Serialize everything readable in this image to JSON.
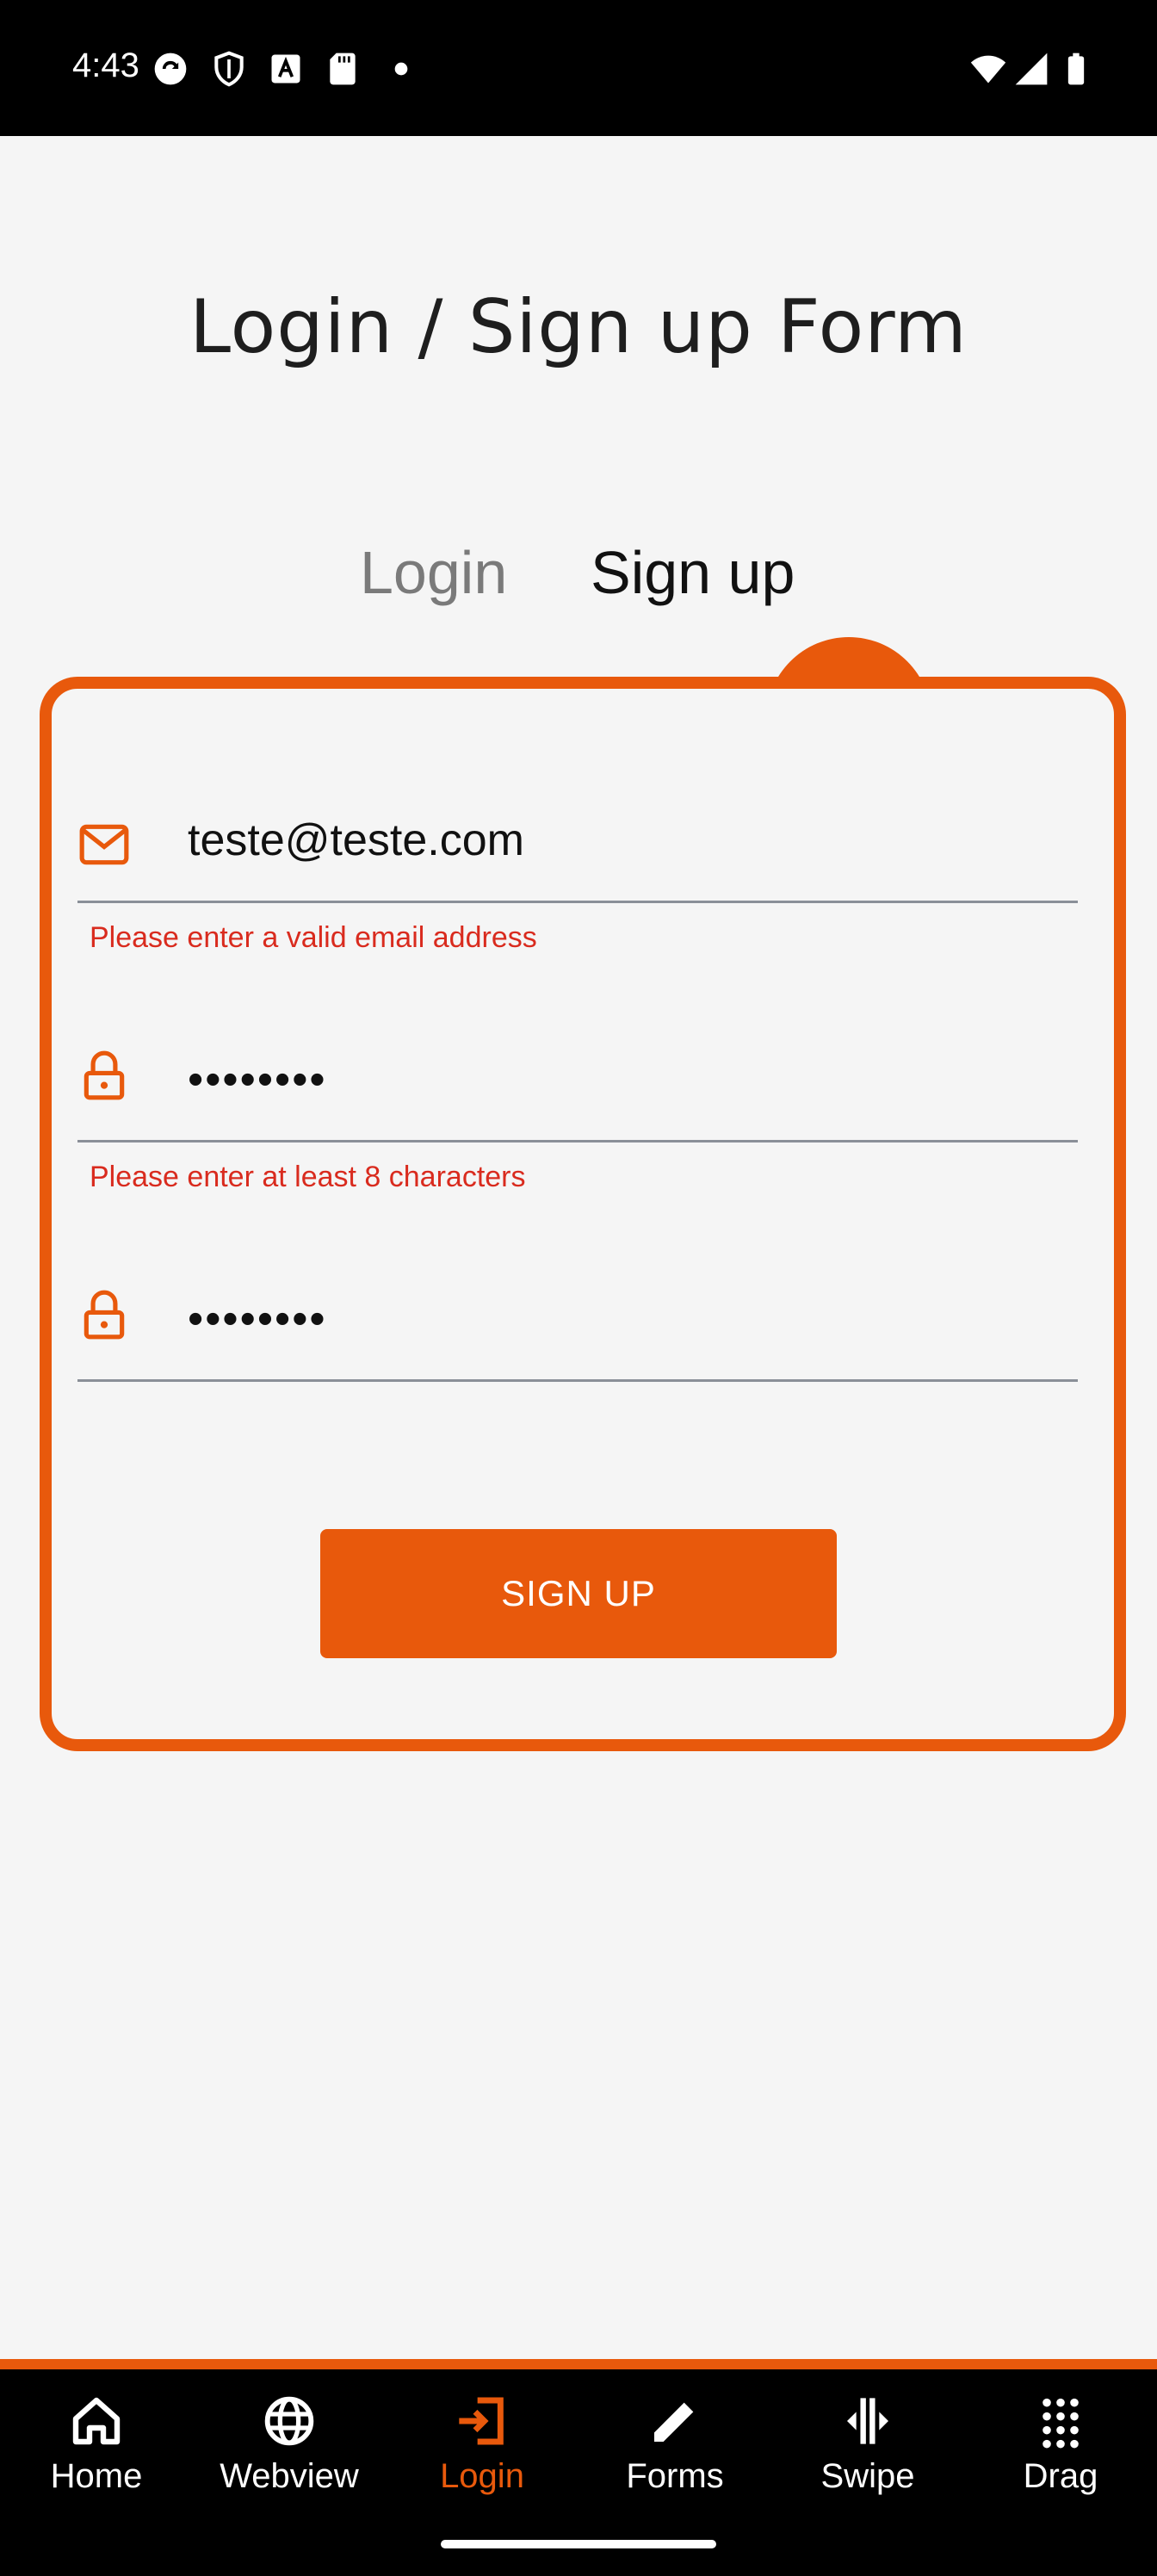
{
  "status_bar": {
    "time": "4:43"
  },
  "page": {
    "title": "Login / Sign up Form"
  },
  "tabs": {
    "login": "Login",
    "signup": "Sign up",
    "active": "signup"
  },
  "form": {
    "email": {
      "value": "teste@teste.com",
      "error": "Please enter a valid email address"
    },
    "password": {
      "value": "••••••••",
      "error": "Please enter at least 8 characters"
    },
    "confirm_password": {
      "value": "••••••••"
    },
    "submit_label": "SIGN UP"
  },
  "bottom_nav": {
    "items": [
      {
        "label": "Home",
        "icon": "home-icon"
      },
      {
        "label": "Webview",
        "icon": "globe-icon"
      },
      {
        "label": "Login",
        "icon": "login-icon",
        "active": true
      },
      {
        "label": "Forms",
        "icon": "pencil-icon"
      },
      {
        "label": "Swipe",
        "icon": "swipe-icon"
      },
      {
        "label": "Drag",
        "icon": "grid-icon"
      }
    ]
  },
  "colors": {
    "accent": "#e8590c",
    "error": "#d92b1e"
  }
}
